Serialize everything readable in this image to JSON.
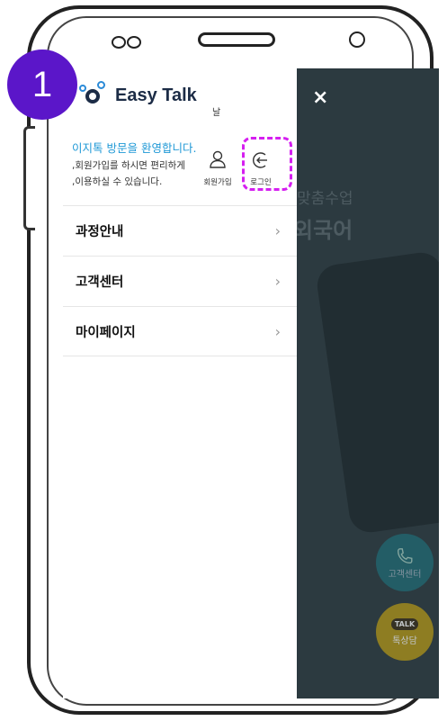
{
  "step_badge": "1",
  "app": {
    "logo_text": "Easy Talk",
    "logo_tiny": "날"
  },
  "close_label": "×",
  "welcome": {
    "title": "이지톡 방문을 환영합니다.",
    "line1": ",회원가입를 하시면 편리하게",
    "line2": ",이용하실 수 있습니다."
  },
  "actions": {
    "signup_label": "회원가입",
    "login_label": "로그인"
  },
  "menu": {
    "items": [
      {
        "label": "과정안내",
        "chevron": "›"
      },
      {
        "label": "고객센터",
        "chevron": "›"
      },
      {
        "label": "마이페이지",
        "chevron": "›"
      }
    ]
  },
  "background": {
    "text1": "맞춤수업",
    "text2": "외국어"
  },
  "fab": {
    "call_label": "고객센터",
    "talk_badge": "TALK",
    "talk_label": "톡상담"
  },
  "colors": {
    "badge": "#5b16c9",
    "highlight": "#d51ff0",
    "welcome_accent": "#1e98d6"
  }
}
